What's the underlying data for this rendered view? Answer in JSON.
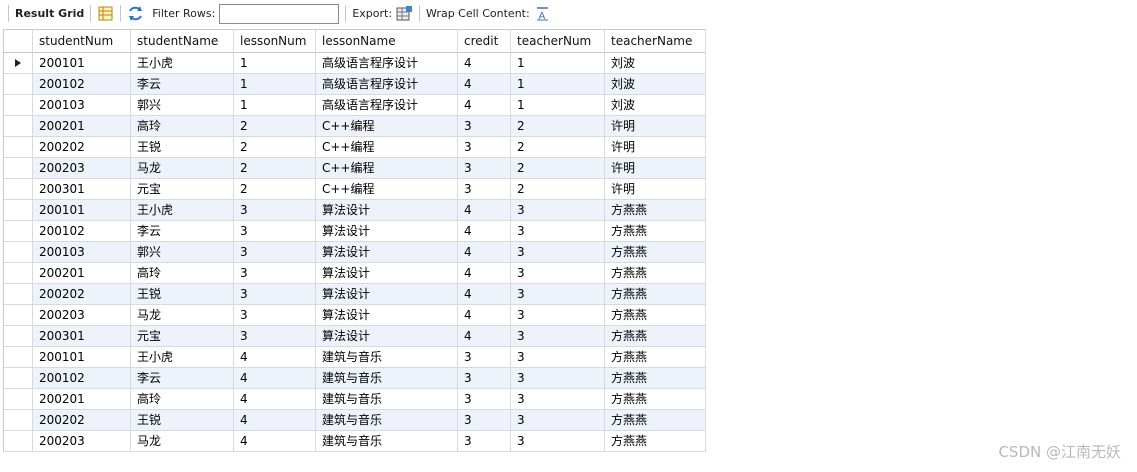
{
  "toolbar": {
    "result_grid": "Result Grid",
    "filter_rows": "Filter Rows:",
    "filter_value": "",
    "export": "Export:",
    "wrap": "Wrap Cell Content:"
  },
  "columns": [
    "studentNum",
    "studentName",
    "lessonNum",
    "lessonName",
    "credit",
    "teacherNum",
    "teacherName"
  ],
  "rows": [
    [
      "200101",
      "王小虎",
      "1",
      "高级语言程序设计",
      "4",
      "1",
      "刘波"
    ],
    [
      "200102",
      "李云",
      "1",
      "高级语言程序设计",
      "4",
      "1",
      "刘波"
    ],
    [
      "200103",
      "郭兴",
      "1",
      "高级语言程序设计",
      "4",
      "1",
      "刘波"
    ],
    [
      "200201",
      "高玲",
      "2",
      "C++编程",
      "3",
      "2",
      "许明"
    ],
    [
      "200202",
      "王锐",
      "2",
      "C++编程",
      "3",
      "2",
      "许明"
    ],
    [
      "200203",
      "马龙",
      "2",
      "C++编程",
      "3",
      "2",
      "许明"
    ],
    [
      "200301",
      "元宝",
      "2",
      "C++编程",
      "3",
      "2",
      "许明"
    ],
    [
      "200101",
      "王小虎",
      "3",
      "算法设计",
      "4",
      "3",
      "方燕燕"
    ],
    [
      "200102",
      "李云",
      "3",
      "算法设计",
      "4",
      "3",
      "方燕燕"
    ],
    [
      "200103",
      "郭兴",
      "3",
      "算法设计",
      "4",
      "3",
      "方燕燕"
    ],
    [
      "200201",
      "高玲",
      "3",
      "算法设计",
      "4",
      "3",
      "方燕燕"
    ],
    [
      "200202",
      "王锐",
      "3",
      "算法设计",
      "4",
      "3",
      "方燕燕"
    ],
    [
      "200203",
      "马龙",
      "3",
      "算法设计",
      "4",
      "3",
      "方燕燕"
    ],
    [
      "200301",
      "元宝",
      "3",
      "算法设计",
      "4",
      "3",
      "方燕燕"
    ],
    [
      "200101",
      "王小虎",
      "4",
      "建筑与音乐",
      "3",
      "3",
      "方燕燕"
    ],
    [
      "200102",
      "李云",
      "4",
      "建筑与音乐",
      "3",
      "3",
      "方燕燕"
    ],
    [
      "200201",
      "高玲",
      "4",
      "建筑与音乐",
      "3",
      "3",
      "方燕燕"
    ],
    [
      "200202",
      "王锐",
      "4",
      "建筑与音乐",
      "3",
      "3",
      "方燕燕"
    ],
    [
      "200203",
      "马龙",
      "4",
      "建筑与音乐",
      "3",
      "3",
      "方燕燕"
    ]
  ],
  "watermark": "CSDN @江南无妖"
}
